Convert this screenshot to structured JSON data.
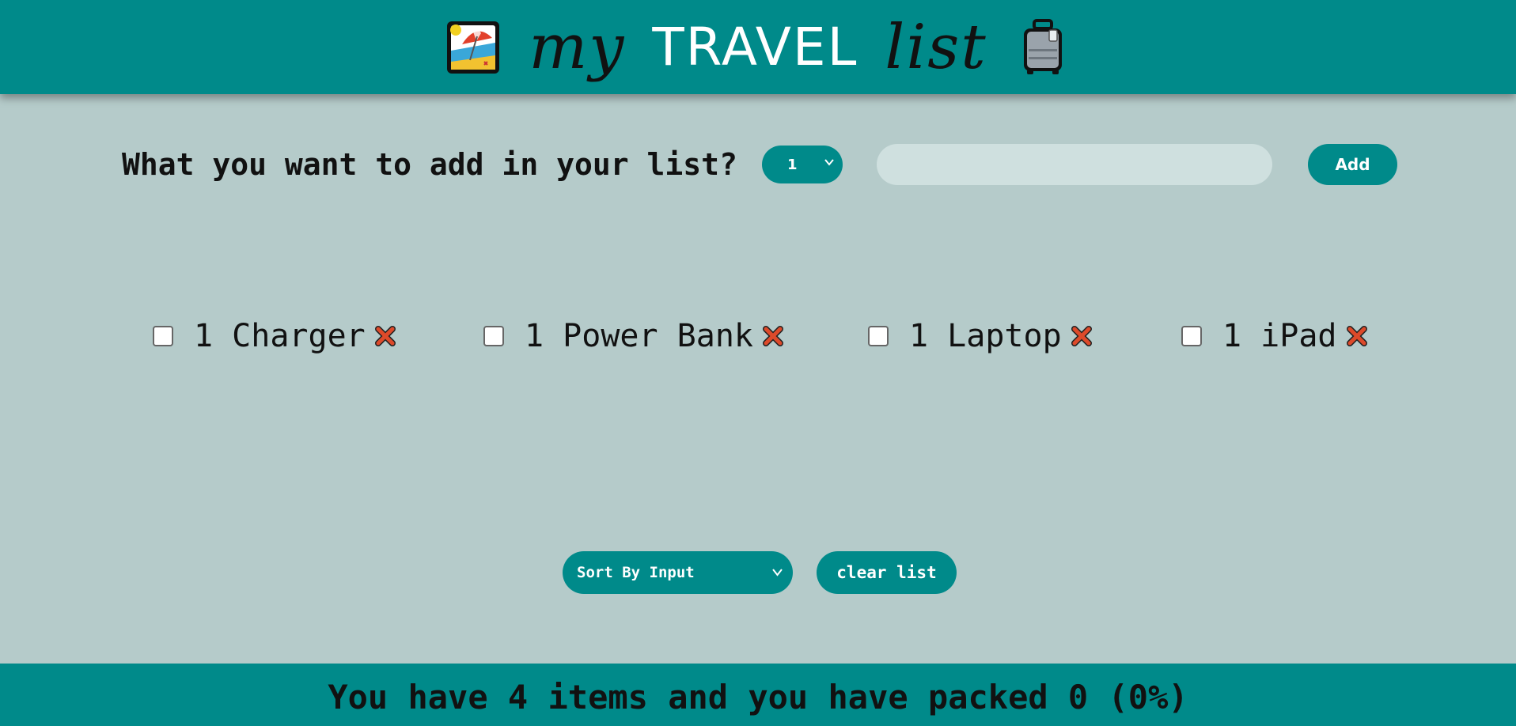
{
  "header": {
    "title_my": "my",
    "title_travel": "TRAVEL",
    "title_list": "list",
    "left_icon": "beach-umbrella-icon",
    "right_icon": "luggage-icon"
  },
  "form": {
    "question": "What you want to add in your list?",
    "quantity_selected": "1",
    "item_input_value": "",
    "item_input_placeholder": "",
    "add_label": "Add"
  },
  "items": [
    {
      "label": "1 Charger",
      "packed": false
    },
    {
      "label": "1 Power Bank",
      "packed": false
    },
    {
      "label": "1 Laptop",
      "packed": false
    },
    {
      "label": "1 iPad",
      "packed": false
    }
  ],
  "controls": {
    "sort_selected": "Sort By Input",
    "clear_label": "clear list"
  },
  "footer": {
    "stats": "You have 4 items and you have packed 0 (0%)"
  },
  "colors": {
    "accent": "#008a8a",
    "background": "#b5cbca",
    "input_bg": "#cfe0df",
    "delete": "#dd4a2a"
  }
}
